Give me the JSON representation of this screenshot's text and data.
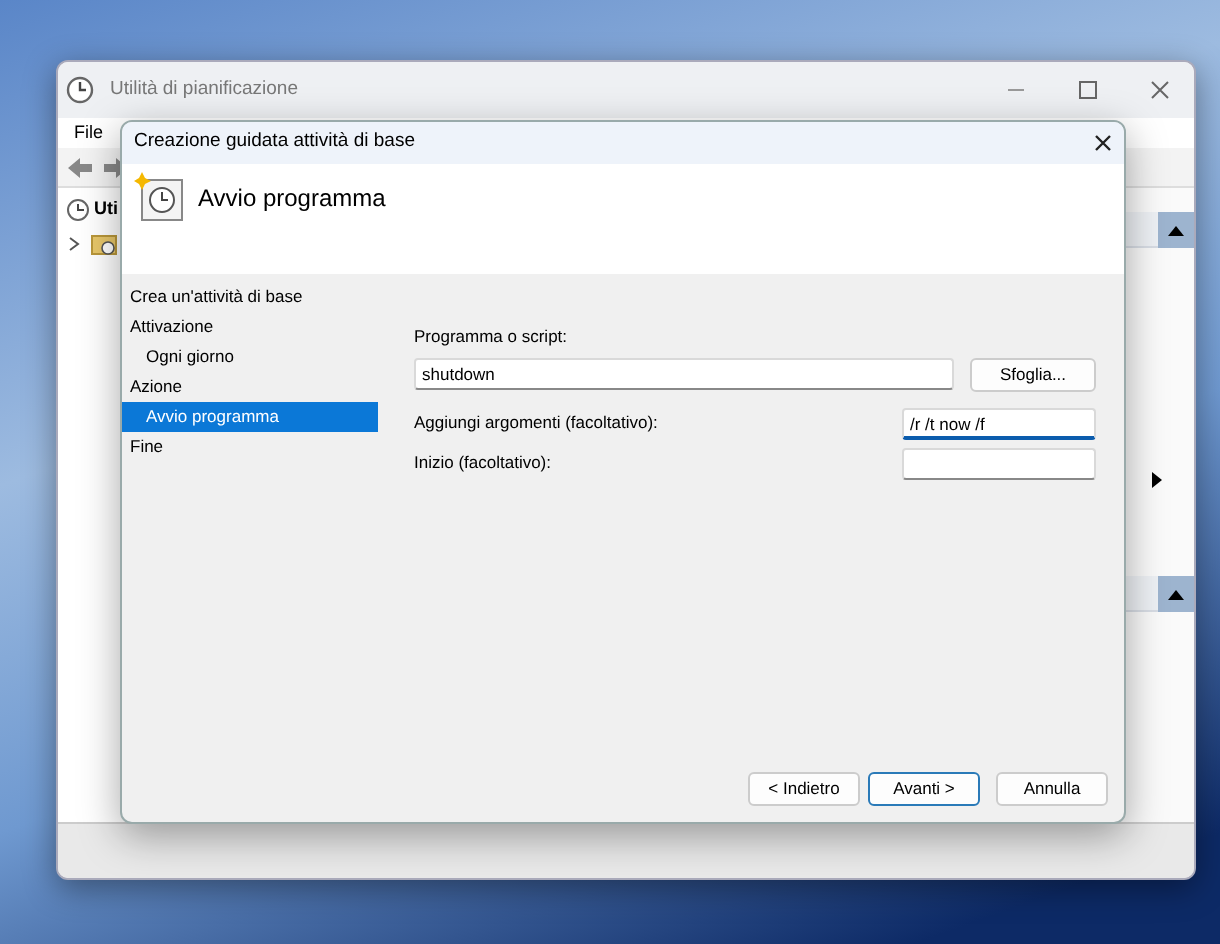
{
  "window": {
    "title": "Utilità di pianificazione",
    "menu": [
      "File"
    ],
    "tree": [
      {
        "label": "Uti"
      }
    ]
  },
  "dialog": {
    "title": "Creazione guidata attività di base",
    "header": "Avvio programma",
    "section_title": "Crea un'attività di base",
    "steps": [
      {
        "label": "Attivazione",
        "selected": false,
        "children": [
          {
            "label": "Ogni giorno",
            "selected": false
          }
        ]
      },
      {
        "label": "Azione",
        "selected": false,
        "children": [
          {
            "label": "Avvio programma",
            "selected": true
          }
        ]
      },
      {
        "label": "Fine",
        "selected": false
      }
    ],
    "fields": [
      {
        "kind": "wide",
        "label": "Programma o script:",
        "value": "shutdown",
        "focused": false,
        "button": "Sfoglia..."
      },
      {
        "kind": "inline",
        "label": "Aggiungi argomenti (facoltativo):",
        "value": "/r /t now /f",
        "focused": true
      },
      {
        "kind": "inline",
        "label": "Inizio (facoltativo):",
        "focused": false
      }
    ],
    "buttons": [
      {
        "label": "< Indietro",
        "default": false
      },
      {
        "label": "Avanti >",
        "default": true
      },
      {
        "label": "Annulla",
        "default": false
      }
    ]
  }
}
